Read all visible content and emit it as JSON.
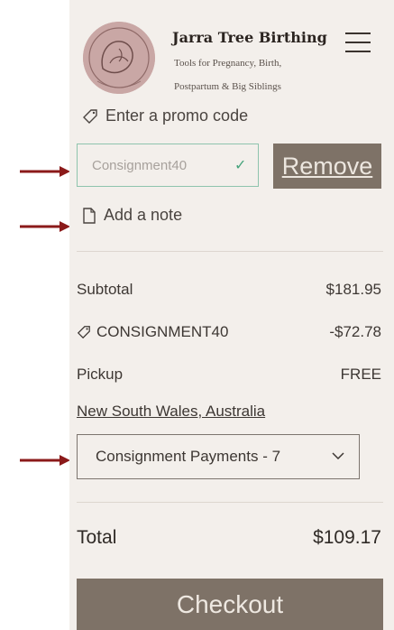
{
  "colors": {
    "panel_bg": "#f3efeb",
    "button_bg": "#7e7267",
    "accent_green": "#46a37b",
    "input_border": "#8ec4ad",
    "annotation_arrow": "#8b1a1a"
  },
  "header": {
    "brand_title": "Jarra Tree Birthing",
    "tagline_line1": "Tools for Pregnancy, Birth,",
    "tagline_line2": "Postpartum & Big Siblings",
    "logo_icon": "jarra-tree-logo"
  },
  "promo": {
    "link_label": "Enter a promo code",
    "input_value": "Consignment40",
    "remove_label": "Remove"
  },
  "note": {
    "link_label": "Add a note"
  },
  "summary": {
    "subtotal_label": "Subtotal",
    "subtotal_value": "$181.95",
    "discount_label": "CONSIGNMENT40",
    "discount_value": "-$72.78",
    "pickup_label": "Pickup",
    "pickup_value": "FREE",
    "pickup_location": "New South Wales, Australia",
    "pickup_option_selected": "Consignment Payments - 7"
  },
  "total": {
    "label": "Total",
    "value": "$109.17"
  },
  "checkout": {
    "label": "Checkout"
  }
}
